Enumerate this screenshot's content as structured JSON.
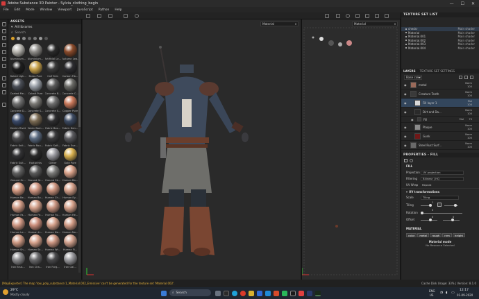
{
  "window": {
    "title": "Adobe Substance 3D Painter - Sylvia_clothing_begin",
    "controls": [
      "—",
      "☐",
      "✕"
    ]
  },
  "menu": [
    "File",
    "Edit",
    "Mode",
    "Window",
    "Viewport",
    "JavaScript",
    "Python",
    "Help"
  ],
  "assets": {
    "header": "ASSETS",
    "library": "All libraries",
    "search_placeholder": "Search",
    "items": [
      {
        "label": "Aluminium...",
        "color": "#b8b6b0"
      },
      {
        "label": "Aluminium...",
        "color": "#8e8c88"
      },
      {
        "label": "Artificial Le...",
        "color": "#2a2a2a"
      },
      {
        "label": "Autumn Lea...",
        "color": "#8a4a2a"
      },
      {
        "label": "Baked Ligh...",
        "color": "#1e1e1e"
      },
      {
        "label": "Brass Pure",
        "color": "#c9a24a"
      },
      {
        "label": "Calf Skin",
        "color": "#3a3a3a"
      },
      {
        "label": "Carbon Fib...",
        "color": "#2c2c30"
      },
      {
        "label": "Coated Me...",
        "color": "#4a4e56"
      },
      {
        "label": "Cobalt Pure",
        "color": "#9aa0a8"
      },
      {
        "label": "Concrete B...",
        "color": "#5a5a5a"
      },
      {
        "label": "Concrete C...",
        "color": "#6a6a66"
      },
      {
        "label": "Concrete D...",
        "color": "#707070"
      },
      {
        "label": "Concrete S...",
        "color": "#7a7874"
      },
      {
        "label": "Concrete S...",
        "color": "#6e6e6e"
      },
      {
        "label": "Copper Pure",
        "color": "#c9785a"
      },
      {
        "label": "Denim Rivet",
        "color": "#3a4a6a"
      },
      {
        "label": "Fabric Bam...",
        "color": "#7a6a52"
      },
      {
        "label": "Fabric Bas...",
        "color": "#2e2e30"
      },
      {
        "label": "Fabric Den...",
        "color": "#3c4a62"
      },
      {
        "label": "Fabric Knit...",
        "color": "#4a4a4c"
      },
      {
        "label": "Fabric Rou...",
        "color": "#5a6a80"
      },
      {
        "label": "Fabric Soft...",
        "color": "#3a3a3c"
      },
      {
        "label": "Fabric Sue...",
        "color": "#5a5a5e"
      },
      {
        "label": "Fabric Suit...",
        "color": "#323234"
      },
      {
        "label": "Footprints",
        "color": "#2a2a2a"
      },
      {
        "label": "Glitter",
        "color": "#9a9aa0"
      },
      {
        "label": "Gold Pure",
        "color": "#d8b050"
      },
      {
        "label": "Ground Gr...",
        "color": "#606060"
      },
      {
        "label": "Ground Gr...",
        "color": "#5a5a5a"
      },
      {
        "label": "Ground Sk...",
        "color": "#7a7a78"
      },
      {
        "label": "Human Ba...",
        "color": "#d8a088"
      },
      {
        "label": "Human Be...",
        "color": "#d49a82"
      },
      {
        "label": "Human Bo...",
        "color": "#d09682"
      },
      {
        "label": "Human Ch...",
        "color": "#cc947e"
      },
      {
        "label": "Human Ey...",
        "color": "#d4a08a"
      },
      {
        "label": "Human Fa...",
        "color": "#cf9a84"
      },
      {
        "label": "Human Fe...",
        "color": "#d3a08a"
      },
      {
        "label": "Human Fo...",
        "color": "#c99480"
      },
      {
        "label": "Human He...",
        "color": "#d6a28c"
      },
      {
        "label": "Human Le...",
        "color": "#d09884"
      },
      {
        "label": "Human Li...",
        "color": "#cc8e7c"
      },
      {
        "label": "Human Ne...",
        "color": "#d4a08a"
      },
      {
        "label": "Human No...",
        "color": "#d29c86"
      },
      {
        "label": "Human Sh...",
        "color": "#ce9a84"
      },
      {
        "label": "Human Sk...",
        "color": "#d8a48e"
      },
      {
        "label": "Human Wr...",
        "color": "#cc9682"
      },
      {
        "label": "Human Fi...",
        "color": "#d0a08c"
      },
      {
        "label": "Iron Brus...",
        "color": "#8a8a8c"
      },
      {
        "label": "Iron Cha...",
        "color": "#6a6a6c"
      },
      {
        "label": "Iron Forg...",
        "color": "#4a4a4c"
      },
      {
        "label": "Iron Gal...",
        "color": "#9a9a9e"
      }
    ]
  },
  "viewport": {
    "mode_3d": "Material",
    "mode_2d": "Material"
  },
  "texture_set_list": {
    "header": "TEXTURE SET LIST",
    "rows": [
      {
        "name": "checkr",
        "shader": "Main shader"
      },
      {
        "name": "Material",
        "shader": "Main shader"
      },
      {
        "name": "Material.001",
        "shader": "Main shader"
      },
      {
        "name": "Material.002",
        "shader": "Main shader"
      },
      {
        "name": "Material.003",
        "shader": "Main shader"
      },
      {
        "name": "Material.004",
        "shader": "Main shader"
      }
    ]
  },
  "layers": {
    "tab_layers": "LAYERS",
    "tab_settings": "TEXTURE SET SETTINGS",
    "channel": "Base color",
    "items": [
      {
        "name": "metal",
        "blend": "Norm",
        "opacity": "100",
        "color": "#9a6a5a"
      },
      {
        "name": "Creature Teeth",
        "blend": "Norm",
        "opacity": "100",
        "color": "#3a3a3a"
      },
      {
        "name": "Fill layer 1",
        "blend": "Mul",
        "opacity": "100",
        "color": "#d8d8d8"
      },
      {
        "name": "Dirt and Da...",
        "blend": "Norm",
        "opacity": "100",
        "color": "#2a2a2a"
      },
      {
        "name": "Fill",
        "blend": "Mul",
        "opacity": "75",
        "color": "#3a3a3a"
      },
      {
        "name": "Plaque",
        "blend": "Norm",
        "opacity": "100",
        "color": "#8a8a8a"
      },
      {
        "name": "Gunk",
        "blend": "Norm",
        "opacity": "100",
        "color": "#701818"
      },
      {
        "name": "Steel Rust Surf...",
        "blend": "Norm",
        "opacity": "100",
        "color": "#6a6a6a"
      }
    ]
  },
  "properties": {
    "header": "PROPERTIES - FILL",
    "fill_label": "FILL",
    "projection_label": "Projection",
    "projection_value": "UV projection",
    "filtering_label": "Filtering",
    "filtering_value": "Bilinear | HQ",
    "wrap_label": "UV Wrap",
    "wrap_value": "Repeat",
    "uv_transform": "UV transformations",
    "scale_label": "Scale",
    "scale_value": "Tiling",
    "tiling_label": "Tiling",
    "tiling_value": "1",
    "rotation_label": "Rotation",
    "rotation_value": "0",
    "offset_label": "Offset",
    "offset_x": "0",
    "offset_y": "0",
    "material_label": "MATERIAL",
    "channels": [
      "color",
      "metal",
      "rough",
      "nrm",
      "height"
    ],
    "material_mode_label": "Material mode",
    "material_mode_value": "No Resource Selected"
  },
  "status": {
    "message": "[MapExporter] The map 'low_poly_substance:1_Material.002_Emissive' can't be generated for the texture set 'Material.002'.",
    "right": "Cache Disk Usage: 33% | Version: 8.1.0"
  },
  "taskbar": {
    "weather_temp": "29°C",
    "weather_desc": "Mostly cloudy",
    "search": "Search",
    "lang": "ENG",
    "region": "US",
    "time": "12:17",
    "date": "01-09-2020"
  }
}
